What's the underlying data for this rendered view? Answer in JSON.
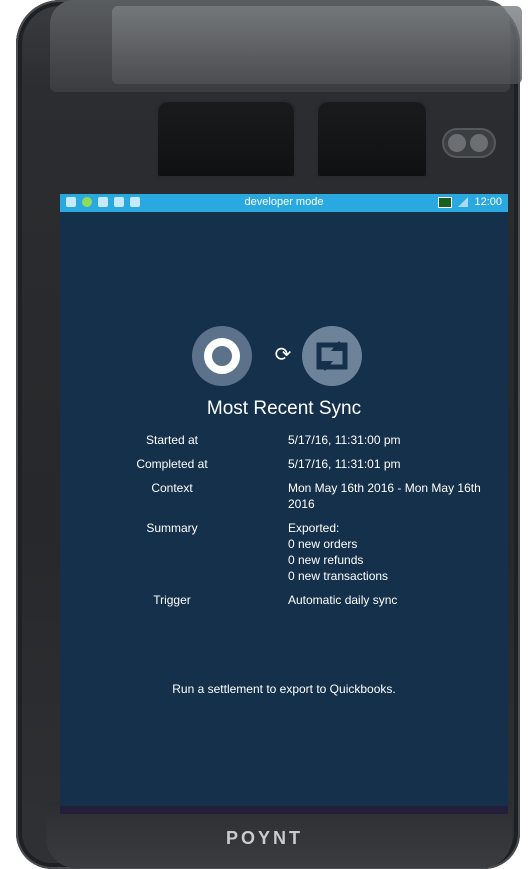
{
  "device": {
    "brand": "POYNT"
  },
  "statusbar": {
    "mode_label": "developer mode",
    "time": "12:00"
  },
  "header": {
    "title": "Most Recent Sync"
  },
  "details": [
    {
      "label": "Started at",
      "values": [
        "5/17/16, 11:31:00 pm"
      ]
    },
    {
      "label": "Completed at",
      "values": [
        "5/17/16, 11:31:01 pm"
      ]
    },
    {
      "label": "Context",
      "values": [
        "Mon May 16th 2016 - Mon May 16th 2016"
      ]
    },
    {
      "label": "Summary",
      "values": [
        "Exported:",
        "0 new orders",
        "0 new refunds",
        "0 new transactions"
      ]
    },
    {
      "label": "Trigger",
      "values": [
        "Automatic daily sync"
      ]
    }
  ],
  "footer_note": "Run a settlement to export to Quickbooks.",
  "colors": {
    "screen_bg": "#14304a",
    "statusbar": "#2aa8e0"
  },
  "icons": {
    "app_logo": "poynt-o-logo",
    "sync": "sync-icon",
    "quickbooks": "quickbooks-icon"
  }
}
